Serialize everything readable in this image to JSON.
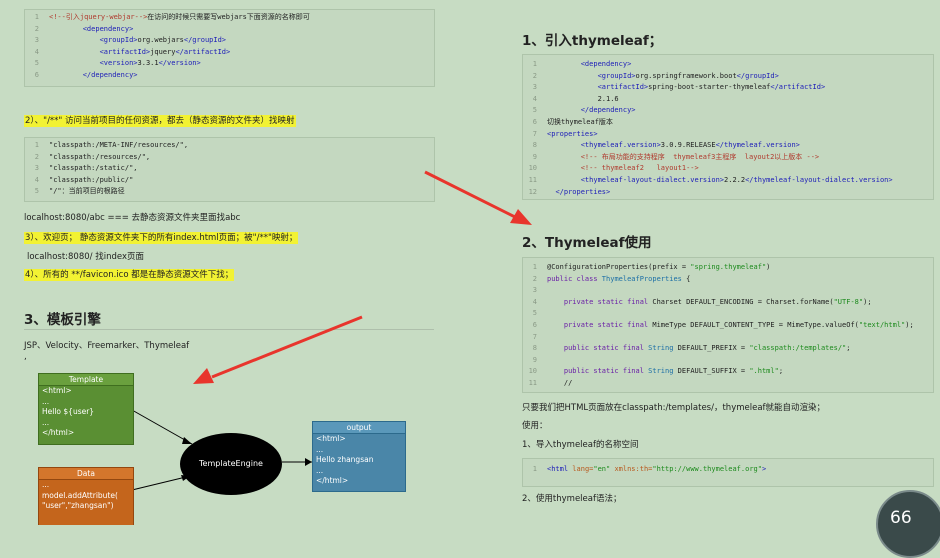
{
  "left": {
    "code1": [
      {
        "n": "1",
        "segs": [
          [
            "com",
            "<!--引入jquery-webjar-->"
          ],
          [
            "",
            "在访问的时候只需要写webjars下面资源的名称即可"
          ]
        ]
      },
      {
        "n": "2",
        "segs": [
          [
            "",
            "        "
          ],
          [
            "tag",
            "<dependency>"
          ]
        ]
      },
      {
        "n": "3",
        "segs": [
          [
            "",
            "            "
          ],
          [
            "tag",
            "<groupId>"
          ],
          [
            "",
            "org.webjars"
          ],
          [
            "tag",
            "</groupId>"
          ]
        ]
      },
      {
        "n": "4",
        "segs": [
          [
            "",
            "            "
          ],
          [
            "tag",
            "<artifactId>"
          ],
          [
            "",
            "jquery"
          ],
          [
            "tag",
            "</artifactId>"
          ]
        ]
      },
      {
        "n": "5",
        "segs": [
          [
            "",
            "            "
          ],
          [
            "tag",
            "<version>"
          ],
          [
            "",
            "3.3.1"
          ],
          [
            "tag",
            "</version>"
          ]
        ]
      },
      {
        "n": "6",
        "segs": [
          [
            "",
            "        "
          ],
          [
            "tag",
            "</dependency>"
          ]
        ]
      }
    ],
    "note2": "2）、\"/**\" 访问当前项目的任何资源，都去（静态资源的文件夹）找映射",
    "code2": [
      {
        "n": "1",
        "segs": [
          [
            "",
            "\"classpath:/META-INF/resources/\","
          ]
        ]
      },
      {
        "n": "2",
        "segs": [
          [
            "",
            "\"classpath:/resources/\","
          ]
        ]
      },
      {
        "n": "3",
        "segs": [
          [
            "",
            "\"classpath:/static/\","
          ]
        ]
      },
      {
        "n": "4",
        "segs": [
          [
            "",
            "\"classpath:/public/\""
          ]
        ]
      },
      {
        "n": "5",
        "segs": [
          [
            "",
            "\"/\"：当前项目的根路径"
          ]
        ]
      }
    ],
    "line_abc": "localhost:8080/abc === 去静态资源文件夹里面找abc",
    "note3": "3）、欢迎页； 静态资源文件夹下的所有index.html页面；被\"/**\"映射；",
    "line_index": "localhost:8080/ 找index页面",
    "note4": "4）、所有的 **/favicon.ico 都是在静态资源文件下找；",
    "heading": "3、模板引擎",
    "engines": "JSP、Velocity、Freemarker、Thymeleaf",
    "dot": ",",
    "template_box": {
      "title": "Template",
      "lines": [
        "<html>",
        "...",
        "Hello ${user}",
        "...",
        "</html>"
      ]
    },
    "data_box": {
      "title": "Data",
      "lines": [
        "...",
        "model.addAttribute(",
        "\"user\",\"zhangsan\")"
      ]
    },
    "engine_label": "TemplateEngine",
    "output_box": {
      "title": "output",
      "lines": [
        "<html>",
        "...",
        "Hello zhangsan",
        "...",
        "</html>"
      ]
    }
  },
  "right": {
    "heading1": "1、引入thymeleaf；",
    "code1": [
      {
        "n": "1",
        "segs": [
          [
            "",
            "        "
          ],
          [
            "tag",
            "<dependency>"
          ]
        ]
      },
      {
        "n": "2",
        "segs": [
          [
            "",
            "            "
          ],
          [
            "tag",
            "<groupId>"
          ],
          [
            "",
            "org.springframework.boot"
          ],
          [
            "tag",
            "</groupId>"
          ]
        ]
      },
      {
        "n": "3",
        "segs": [
          [
            "",
            "            "
          ],
          [
            "tag",
            "<artifactId>"
          ],
          [
            "",
            "spring-boot-starter-thymeleaf"
          ],
          [
            "tag",
            "</artifactId>"
          ]
        ]
      },
      {
        "n": "4",
        "segs": [
          [
            "",
            "            2.1.6"
          ]
        ]
      },
      {
        "n": "5",
        "segs": [
          [
            "",
            "        "
          ],
          [
            "tag",
            "</dependency>"
          ]
        ]
      },
      {
        "n": "6",
        "segs": [
          [
            "",
            "切换thymeleaf版本"
          ]
        ]
      },
      {
        "n": "7",
        "segs": [
          [
            "tag",
            "<properties>"
          ]
        ]
      },
      {
        "n": "8",
        "segs": [
          [
            "",
            "        "
          ],
          [
            "tag",
            "<thymeleaf.version>"
          ],
          [
            "",
            "3.0.9.RELEASE"
          ],
          [
            "tag",
            "</thymeleaf.version>"
          ]
        ]
      },
      {
        "n": "9",
        "segs": [
          [
            "",
            "        "
          ],
          [
            "com",
            "<!-- 布局功能的支持程序  thymeleaf3主程序  layout2以上版本 -->"
          ]
        ]
      },
      {
        "n": "10",
        "segs": [
          [
            "",
            "        "
          ],
          [
            "com",
            "<!-- thymeleaf2   layout1-->"
          ]
        ]
      },
      {
        "n": "11",
        "segs": [
          [
            "",
            "        "
          ],
          [
            "tag",
            "<thymeleaf-layout-dialect.version>"
          ],
          [
            "",
            "2.2.2"
          ],
          [
            "tag",
            "</thymeleaf-layout-dialect.version>"
          ]
        ]
      },
      {
        "n": "12",
        "segs": [
          [
            "",
            "  "
          ],
          [
            "tag",
            "</properties>"
          ]
        ]
      }
    ],
    "heading2": "2、Thymeleaf使用",
    "code2": [
      {
        "n": "1",
        "segs": [
          [
            "",
            "@ConfigurationProperties(prefix = "
          ],
          [
            "str",
            "\"spring.thymeleaf\""
          ],
          [
            "",
            ")"
          ]
        ]
      },
      {
        "n": "2",
        "segs": [
          [
            "kw",
            "public class "
          ],
          [
            "typ",
            "ThymeleafProperties"
          ],
          [
            "",
            " {"
          ]
        ]
      },
      {
        "n": "3",
        "segs": [
          [
            "",
            ""
          ]
        ]
      },
      {
        "n": "4",
        "segs": [
          [
            "",
            "    "
          ],
          [
            "kw",
            "private static final "
          ],
          [
            "",
            "Charset DEFAULT_ENCODING = Charset.forName("
          ],
          [
            "str",
            "\"UTF-8\""
          ],
          [
            "",
            ");"
          ]
        ]
      },
      {
        "n": "5",
        "segs": [
          [
            "",
            ""
          ]
        ]
      },
      {
        "n": "6",
        "segs": [
          [
            "",
            "    "
          ],
          [
            "kw",
            "private static final "
          ],
          [
            "",
            "MimeType DEFAULT_CONTENT_TYPE = MimeType.valueOf("
          ],
          [
            "str",
            "\"text/html\""
          ],
          [
            "",
            ");"
          ]
        ]
      },
      {
        "n": "7",
        "segs": [
          [
            "",
            ""
          ]
        ]
      },
      {
        "n": "8",
        "segs": [
          [
            "",
            "    "
          ],
          [
            "kw",
            "public static final "
          ],
          [
            "typ",
            "String "
          ],
          [
            "",
            "DEFAULT_PREFIX = "
          ],
          [
            "str",
            "\"classpath:/templates/\""
          ],
          [
            "",
            ";"
          ]
        ]
      },
      {
        "n": "9",
        "segs": [
          [
            "",
            ""
          ]
        ]
      },
      {
        "n": "10",
        "segs": [
          [
            "",
            "    "
          ],
          [
            "kw",
            "public static final "
          ],
          [
            "typ",
            "String "
          ],
          [
            "",
            "DEFAULT_SUFFIX = "
          ],
          [
            "str",
            "\".html\""
          ],
          [
            "",
            ";"
          ]
        ]
      },
      {
        "n": "11",
        "segs": [
          [
            "",
            "    //"
          ]
        ]
      }
    ],
    "p1": "只要我们把HTML页面放在classpath:/templates/，thymeleaf就能自动渲染；",
    "p2": "使用：",
    "p3": "1、导入thymeleaf的名称空间",
    "code3": [
      {
        "n": "1",
        "segs": [
          [
            "tag",
            "<html "
          ],
          [
            "attr",
            "lang="
          ],
          [
            "str",
            "\"en\""
          ],
          [
            "attr",
            " xmlns:th="
          ],
          [
            "str",
            "\"http://www.thymeleaf.org\""
          ],
          [
            "tag",
            ">"
          ]
        ]
      }
    ],
    "p4": "2、使用thymeleaf语法；"
  },
  "gauge": "66",
  "colors": {
    "arrow": "#e8352c",
    "green_box": "#5a8f33",
    "orange_box": "#c4651c",
    "blue_box": "#4a86a8",
    "highlight": "#f2f233"
  }
}
